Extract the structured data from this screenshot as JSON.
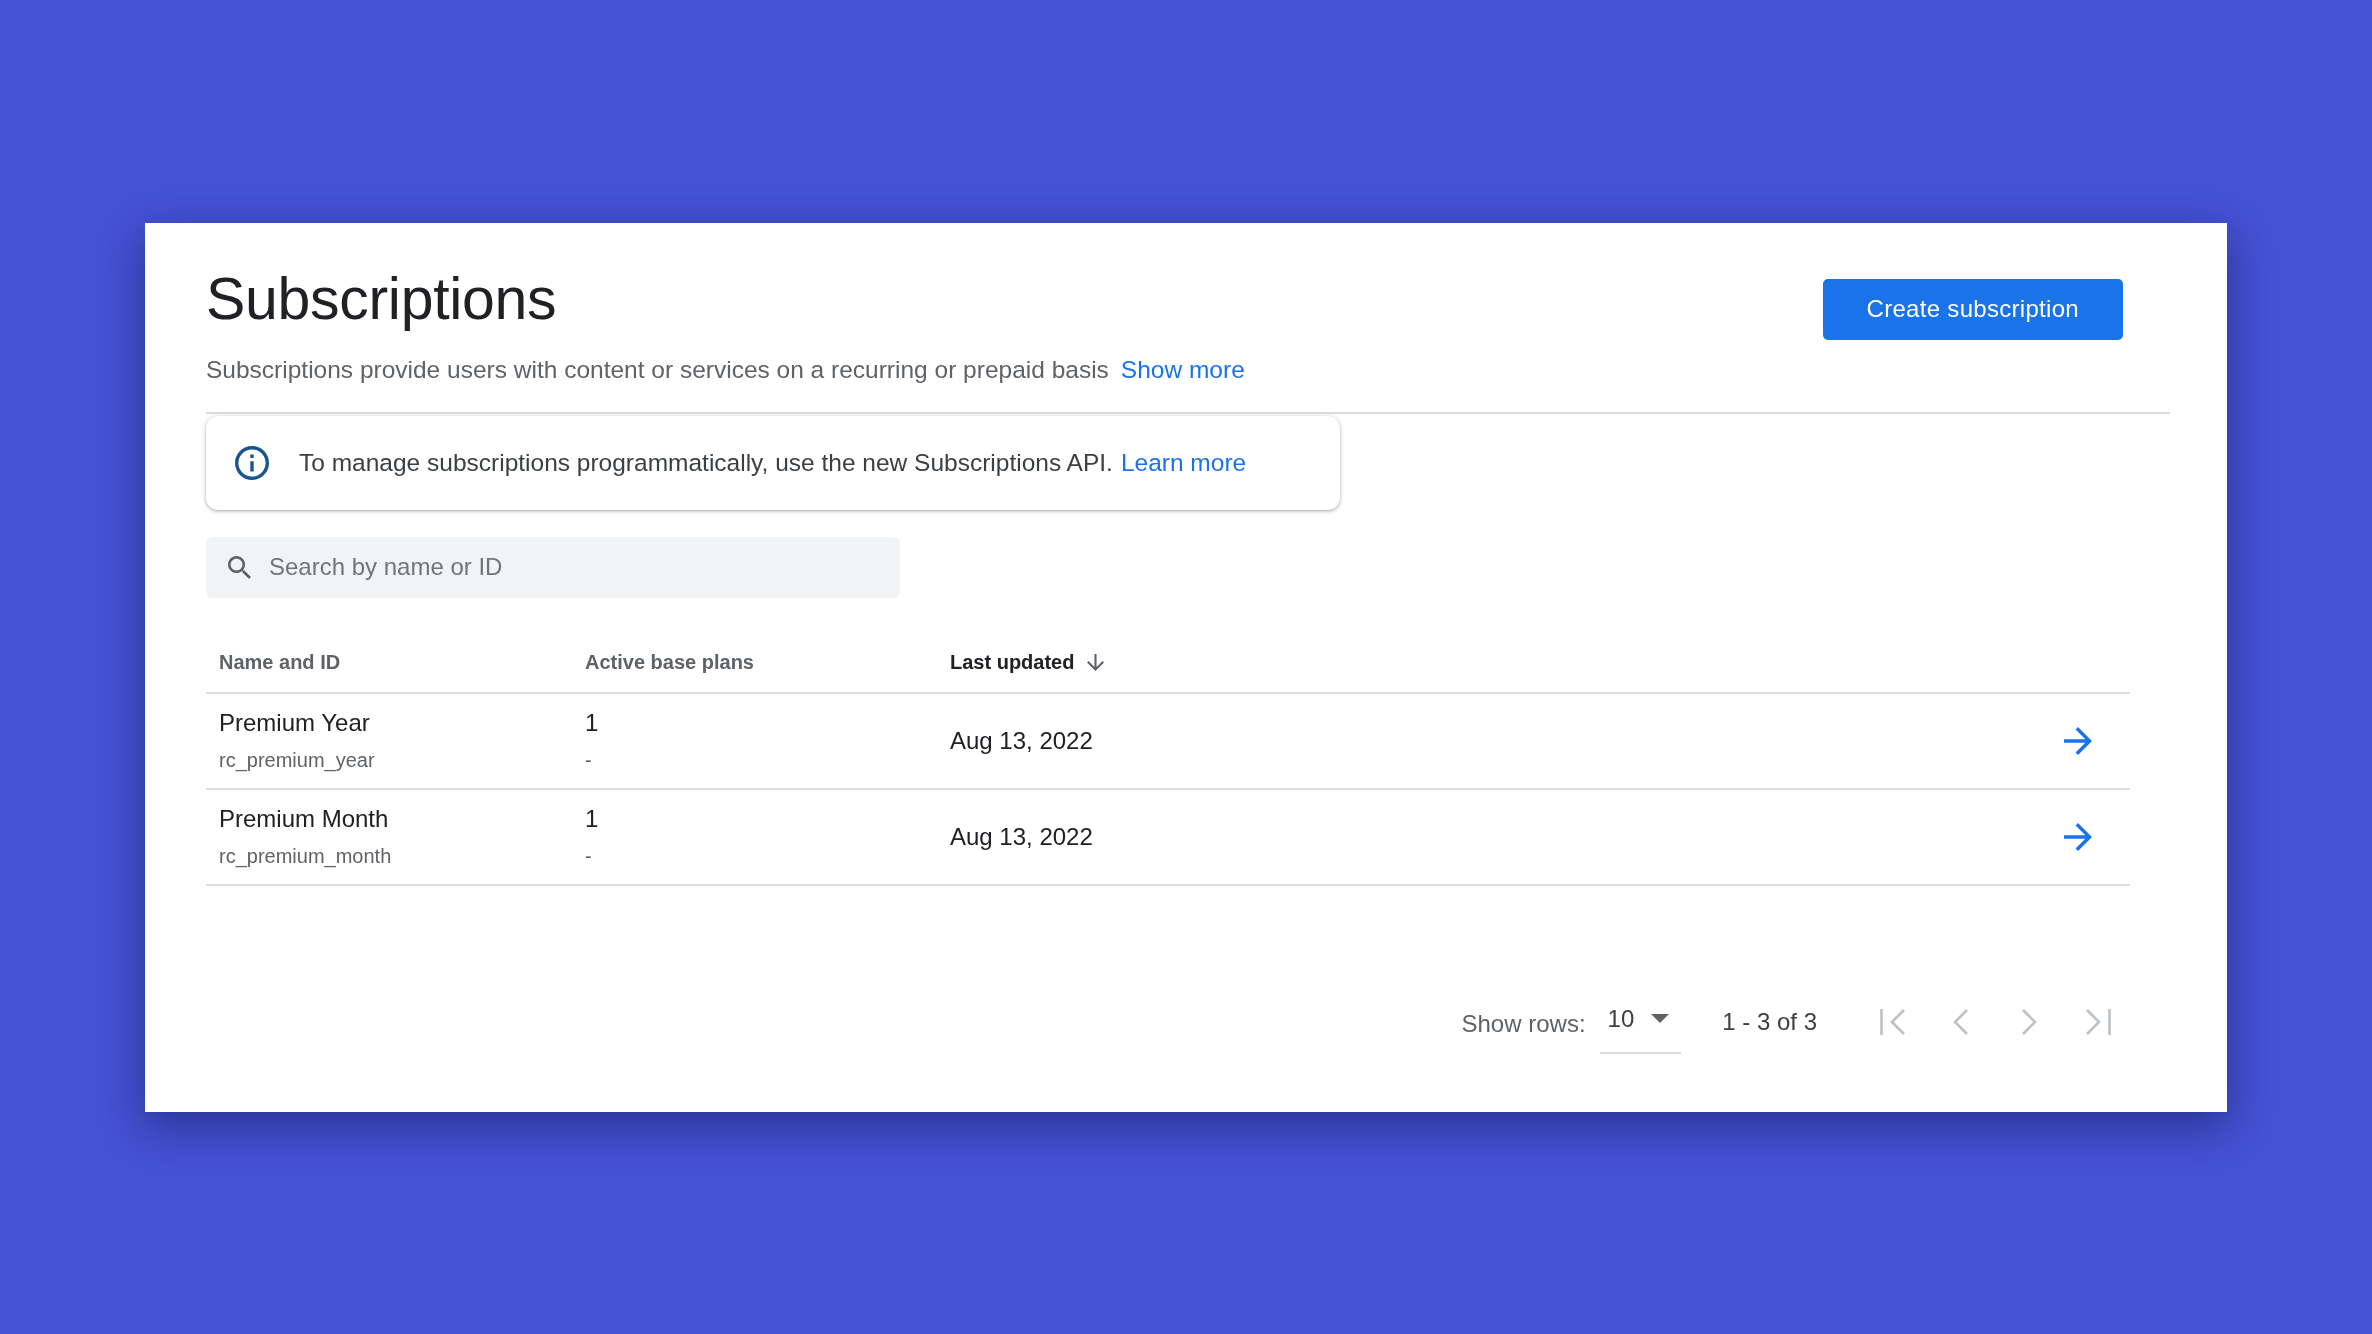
{
  "page": {
    "title": "Subscriptions",
    "description": "Subscriptions provide users with content or services on a recurring or prepaid basis",
    "show_more_link": "Show more",
    "create_button": "Create subscription"
  },
  "info_banner": {
    "text": "To manage subscriptions programmatically, use the new Subscriptions API.",
    "link": "Learn more"
  },
  "search": {
    "placeholder": "Search by name or ID"
  },
  "table": {
    "columns": [
      {
        "label": "Name and ID",
        "sorted": false
      },
      {
        "label": "Active base plans",
        "sorted": false
      },
      {
        "label": "Last updated",
        "sorted": true,
        "descending": true
      }
    ],
    "rows": [
      {
        "name": "Premium Year",
        "id": "rc_premium_year",
        "active_base_plans": "1",
        "base_plans_detail": "-",
        "last_updated": "Aug 13, 2022"
      },
      {
        "name": "Premium Month",
        "id": "rc_premium_month",
        "active_base_plans": "1",
        "base_plans_detail": "-",
        "last_updated": "Aug 13, 2022"
      }
    ]
  },
  "pagination": {
    "rows_label": "Show rows:",
    "rows_per_page": "10",
    "range": "1 - 3 of 3",
    "buttons": [
      {
        "kind": "first",
        "disabled": true
      },
      {
        "kind": "previous",
        "disabled": true
      },
      {
        "kind": "next",
        "disabled": true
      },
      {
        "kind": "last",
        "disabled": true
      }
    ]
  }
}
